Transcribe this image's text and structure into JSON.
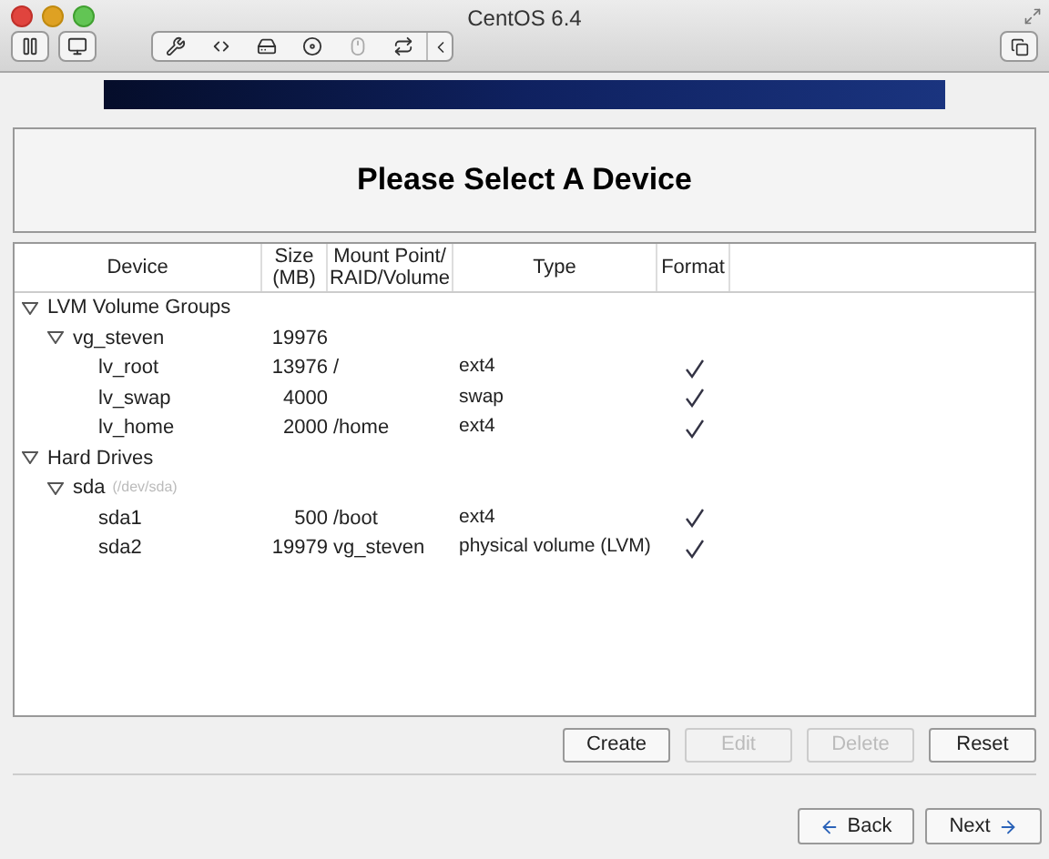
{
  "window": {
    "title": "CentOS 6.4"
  },
  "heading": "Please Select A Device",
  "table": {
    "columns": [
      "Device",
      "Size (MB)",
      "Mount Point/ RAID/Volume",
      "Type",
      "Format"
    ],
    "rows": [
      {
        "device": "LVM Volume Groups",
        "expanded": true,
        "children": [
          {
            "device": "vg_steven",
            "size": "19976",
            "expanded": true,
            "children": [
              {
                "device": "lv_root",
                "size": "13976",
                "mount": "/",
                "type": "ext4",
                "format": true
              },
              {
                "device": "lv_swap",
                "size": "4000",
                "type": "swap",
                "format": true
              },
              {
                "device": "lv_home",
                "size": "2000",
                "mount": "/home",
                "type": "ext4",
                "format": true
              }
            ]
          }
        ]
      },
      {
        "device": "Hard Drives",
        "expanded": true,
        "children": [
          {
            "device": "sda",
            "detail": "(/dev/sda)",
            "expanded": true,
            "children": [
              {
                "device": "sda1",
                "size": "500",
                "mount": "/boot",
                "type": "ext4",
                "format": true
              },
              {
                "device": "sda2",
                "size": "19979",
                "mount": "vg_steven",
                "type": "physical volume (LVM)",
                "format": true
              }
            ]
          }
        ]
      }
    ]
  },
  "actions": [
    {
      "label": "Create",
      "disabled": false
    },
    {
      "label": "Edit",
      "disabled": true
    },
    {
      "label": "Delete",
      "disabled": true
    },
    {
      "label": "Reset",
      "disabled": false
    }
  ],
  "navigation": [
    {
      "label": "Back",
      "kind": "back"
    },
    {
      "label": "Next",
      "kind": "next"
    }
  ]
}
